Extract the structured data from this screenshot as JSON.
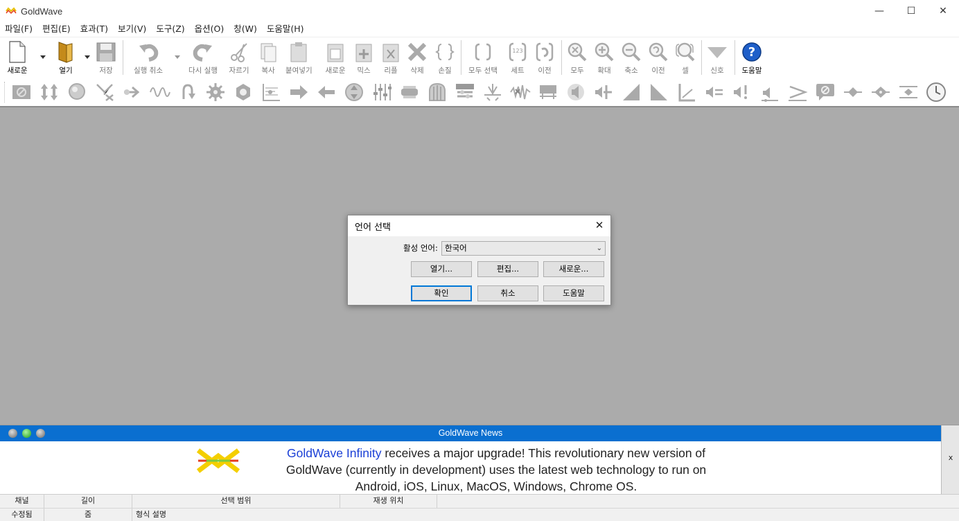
{
  "window": {
    "title": "GoldWave",
    "minimize": "—",
    "maximize": "☐",
    "close": "✕"
  },
  "menu": [
    "파일(F)",
    "편집(E)",
    "효과(T)",
    "보기(V)",
    "도구(Z)",
    "옵션(O)",
    "창(W)",
    "도움말(H)"
  ],
  "toolbar": {
    "new": "새로운",
    "open": "열기",
    "save": "저장",
    "undo": "실행 취소",
    "redo": "다시 실행",
    "cut": "자르기",
    "copy": "복사",
    "paste": "붙여넣기",
    "paste_new": "새로운",
    "mix": "믹스",
    "replace": "리플",
    "delete": "삭제",
    "trim": "손질",
    "select_all": "모두 선택",
    "set": "세트",
    "previous": "이전",
    "zoom_all": "모두",
    "zoom_in": "확대",
    "zoom_out": "축소",
    "zoom_prev": "이전",
    "zoom_cell": "셀",
    "cue": "신호",
    "help": "도움말"
  },
  "dialog": {
    "title": "언어 선택",
    "close": "✕",
    "language_label": "활성 언어:",
    "language_value": "한국어",
    "open_button": "열기...",
    "edit_button": "편집...",
    "new_button": "새로운...",
    "ok_button": "확인",
    "cancel_button": "취소",
    "help_button": "도움말"
  },
  "news": {
    "title": "GoldWave News",
    "close": "x",
    "link_text": "GoldWave Infinity",
    "body_line1": " receives a major upgrade! This revolutionary new version of",
    "body_line2": "GoldWave (currently in development) uses the latest web technology to run on",
    "body_line3": "Android, iOS, Linux, MacOS, Windows, Chrome OS.",
    "link_color": "#1a3fd6",
    "header_color": "#0a6fd0"
  },
  "statusbar": {
    "row1": [
      "채널",
      "길이",
      "선택 범위",
      "재생 위치"
    ],
    "row2": [
      "수정됨",
      "줌",
      "형식 설명"
    ]
  }
}
